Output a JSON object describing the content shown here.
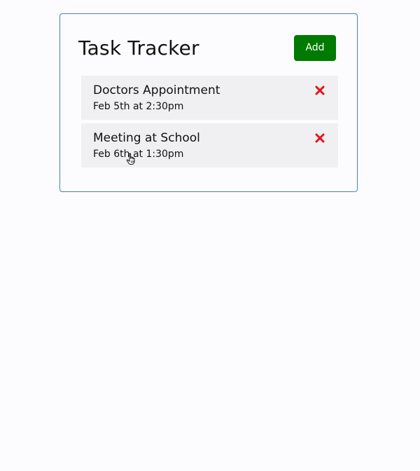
{
  "app": {
    "title": "Task Tracker",
    "add_label": "Add"
  },
  "tasks": [
    {
      "text": "Doctors Appointment",
      "day": "Feb 5th at 2:30pm"
    },
    {
      "text": "Meeting at School",
      "day": "Feb 6th at 1:30pm"
    }
  ],
  "icons": {
    "delete": "close-icon",
    "cursor": "hand-pointer-icon"
  },
  "colors": {
    "accent_button": "#007a00",
    "delete_icon": "#e0151c",
    "task_background": "#f0eff1",
    "container_border": "#4a7fc1"
  }
}
